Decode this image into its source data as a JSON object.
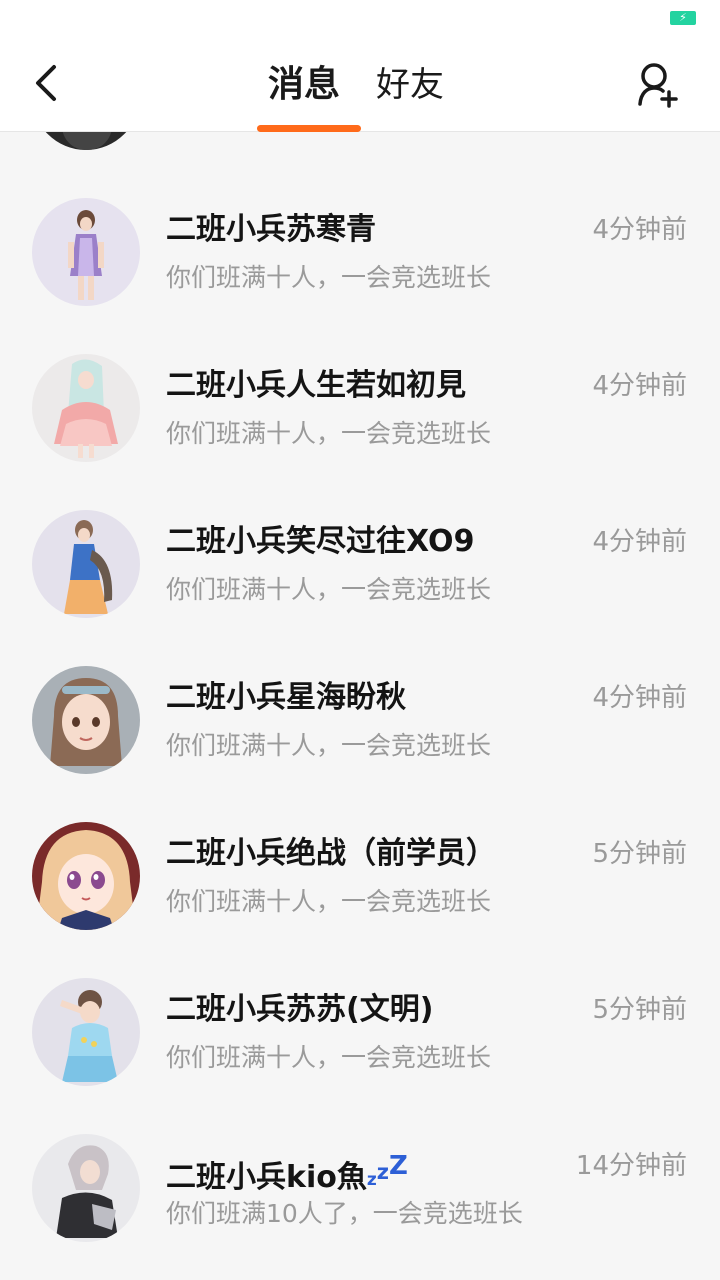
{
  "status_bar": {
    "battery_icon": "battery-charging-icon",
    "battery_color": "#23d3a0"
  },
  "header": {
    "back_icon": "chevron-left-icon",
    "tabs": [
      {
        "label": "消息",
        "active": true
      },
      {
        "label": "好友",
        "active": false
      }
    ],
    "active_tab_color": "#ff6a1a",
    "add_friend_icon": "add-user-icon"
  },
  "conversations": [
    {
      "name": "二班小兵苏寒青",
      "time": "4分钟前",
      "preview": "你们班满十人，一会竞选班长"
    },
    {
      "name": "二班小兵人生若如初見",
      "time": "4分钟前",
      "preview": "你们班满十人，一会竞选班长"
    },
    {
      "name": "二班小兵笑尽过往XO9",
      "time": "4分钟前",
      "preview": "你们班满十人，一会竞选班长"
    },
    {
      "name": "二班小兵星海盼秋",
      "time": "4分钟前",
      "preview": "你们班满十人，一会竞选班长"
    },
    {
      "name": "二班小兵绝战（前学员）",
      "time": "5分钟前",
      "preview": "你们班满十人，一会竞选班长"
    },
    {
      "name": "二班小兵苏苏(文明)",
      "time": "5分钟前",
      "preview": "你们班满十人，一会竞选班长"
    },
    {
      "name": "二班小兵kio魚",
      "name_suffix": [
        "z",
        "z",
        "Z"
      ],
      "time": "14分钟前",
      "preview": "你们班满10人了，一会竞选班长"
    }
  ]
}
